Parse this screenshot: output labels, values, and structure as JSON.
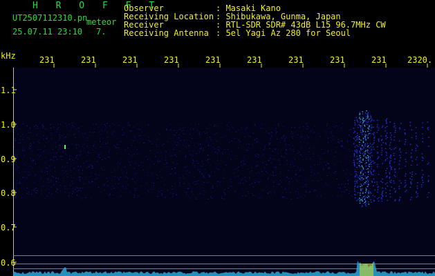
{
  "station": {
    "title": "H R O F F T",
    "filename": "UT2507112310.pn",
    "type": "meteor",
    "datetime": "25.07.11 23:10",
    "frame": "7."
  },
  "info": {
    "observer_label": "Observer",
    "observer_value": ": Masaki Kano",
    "location_label": "Receiving Location",
    "location_value": ": Shibukawa, Gunma, Japan",
    "receiver_label": "Receiver",
    "receiver_value": ": RTL-SDR SDR# 43dB L15 96.7MHz CW",
    "antenna_label": "Receiving Antenna",
    "antenna_value": ": 5el Yagi Az 280 for Seoul"
  },
  "axis": {
    "unit": "kHz",
    "y_ticks": [
      "1.1",
      "1.0",
      "0.9",
      "0.8",
      "0.7",
      "0.6"
    ],
    "x_ticks": [
      "231",
      "231",
      "231",
      "231",
      "231",
      "231",
      "231",
      "231",
      "231",
      "2320."
    ]
  },
  "colors": {
    "background": "#000000",
    "plot_bg": "#03031a",
    "header_green": "#22e03a",
    "text_yellow": "#f2f21a",
    "signal_blue": "#2a3aff",
    "signal_cyan": "#30d8ff"
  }
}
